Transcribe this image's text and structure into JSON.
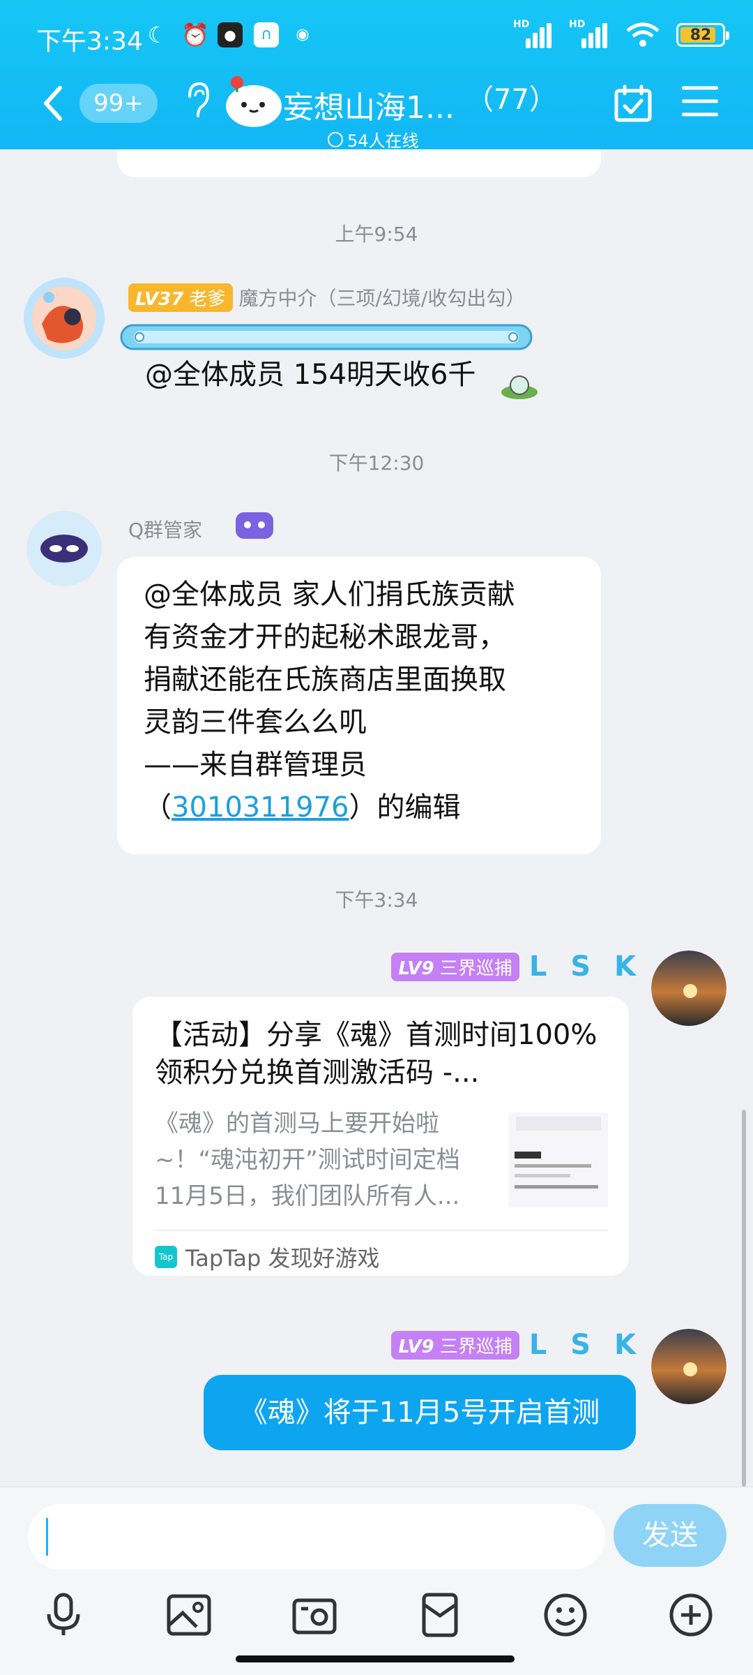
{
  "status_bar": {
    "time": "下午3:34",
    "signal_label": "HD",
    "battery": "82"
  },
  "header": {
    "unread_badge": "99+",
    "group_title": "妄想山海1...",
    "member_count": "（77）",
    "online_text": "54人在线"
  },
  "messages": [
    {
      "type": "timestamp",
      "text": "上午9:54"
    },
    {
      "type": "incoming",
      "level": "LV37",
      "title": "老爹",
      "nickname": "魔方中介（三项/幻境/收勾出勾）",
      "text": "@全体成员 154明天收6千"
    },
    {
      "type": "timestamp",
      "text": "下午12:30"
    },
    {
      "type": "incoming",
      "nickname": "Q群管家",
      "lines": [
        "@全体成员 家人们捐氏族贡献",
        "有资金才开的起秘术跟龙哥，",
        "捐献还能在氏族商店里面换取",
        "灵韵三件套么么叽",
        "——来自群管理员"
      ],
      "link_prefix": "（",
      "link_text": "3010311976",
      "link_suffix": "）的编辑"
    },
    {
      "type": "timestamp",
      "text": "下午3:34"
    },
    {
      "type": "outgoing-card",
      "level": "LV9",
      "title": "三界巡捕",
      "nickname": "L S K",
      "card_title": "【活动】分享《魂》首测时间100%领积分兑换首测激活码 -...",
      "card_desc": "《魂》的首测马上要开始啦~！“魂沌初开”测试时间定档11月5日，我们团队所有人...",
      "card_source": "TapTap 发现好游戏",
      "card_source_icon": "Tap"
    },
    {
      "type": "outgoing",
      "level": "LV9",
      "title": "三界巡捕",
      "nickname": "L S K",
      "text": "《魂》将于11月5号开启首测"
    }
  ],
  "input": {
    "placeholder": "",
    "send_label": "发送"
  },
  "colors": {
    "accent": "#12b7f5",
    "bubble_out": "#0ea5f0",
    "lv_orange": "#f8b62d",
    "lv_purple": "#c580f5"
  }
}
